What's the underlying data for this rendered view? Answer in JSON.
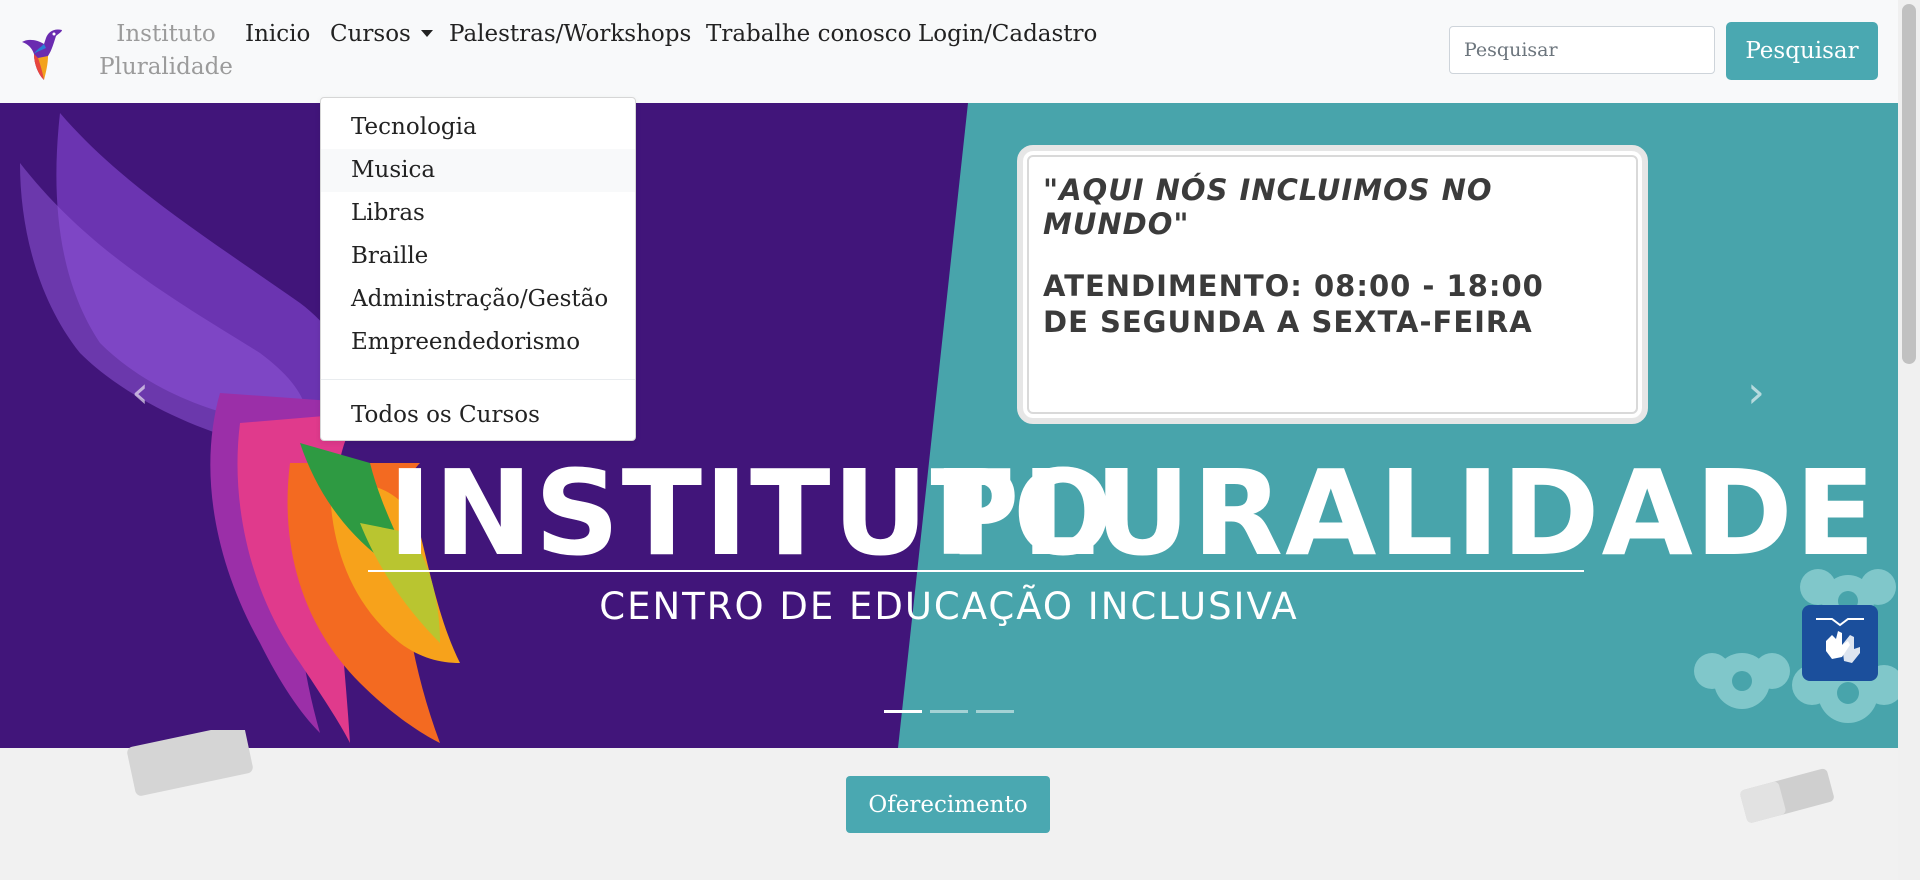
{
  "navbar": {
    "brand_line1": "Instituto",
    "brand_line2": "Pluralidade",
    "links": [
      "Inicio",
      "Cursos",
      "Palestras/Workshops",
      "Trabalhe conosco",
      "Login/Cadastro"
    ],
    "search_placeholder": "Pesquisar",
    "search_button": "Pesquisar"
  },
  "dropdown": {
    "items": [
      "Tecnologia",
      "Musica",
      "Libras",
      "Braille",
      "Administração/Gestão",
      "Empreendedorismo"
    ],
    "all_courses": "Todos os Cursos",
    "hovered_index": 1
  },
  "hero": {
    "quote": "\"AQUI NÓS INCLUIMOS NO MUNDO\"",
    "hours": "ATENDIMENTO: 08:00 - 18:00",
    "days": "DE SEGUNDA A SEXTA-FEIRA",
    "title_left": "INSTITUTO",
    "title_right": "PLURALIDADE",
    "subtitle": "CENTRO DE EDUCAÇÃO INCLUSIVA",
    "indicator_count": 3,
    "active_indicator": 0
  },
  "offer_button": "Oferecimento",
  "colors": {
    "accent": "#4aa8b1",
    "hero_purple": "#41157a",
    "hero_teal": "#48a4ab",
    "libras_blue": "#1b4f9c"
  },
  "icons": [
    "hummingbird-logo-icon",
    "chevron-down-icon",
    "chevron-left-icon",
    "chevron-right-icon",
    "sign-language-hands-icon"
  ]
}
